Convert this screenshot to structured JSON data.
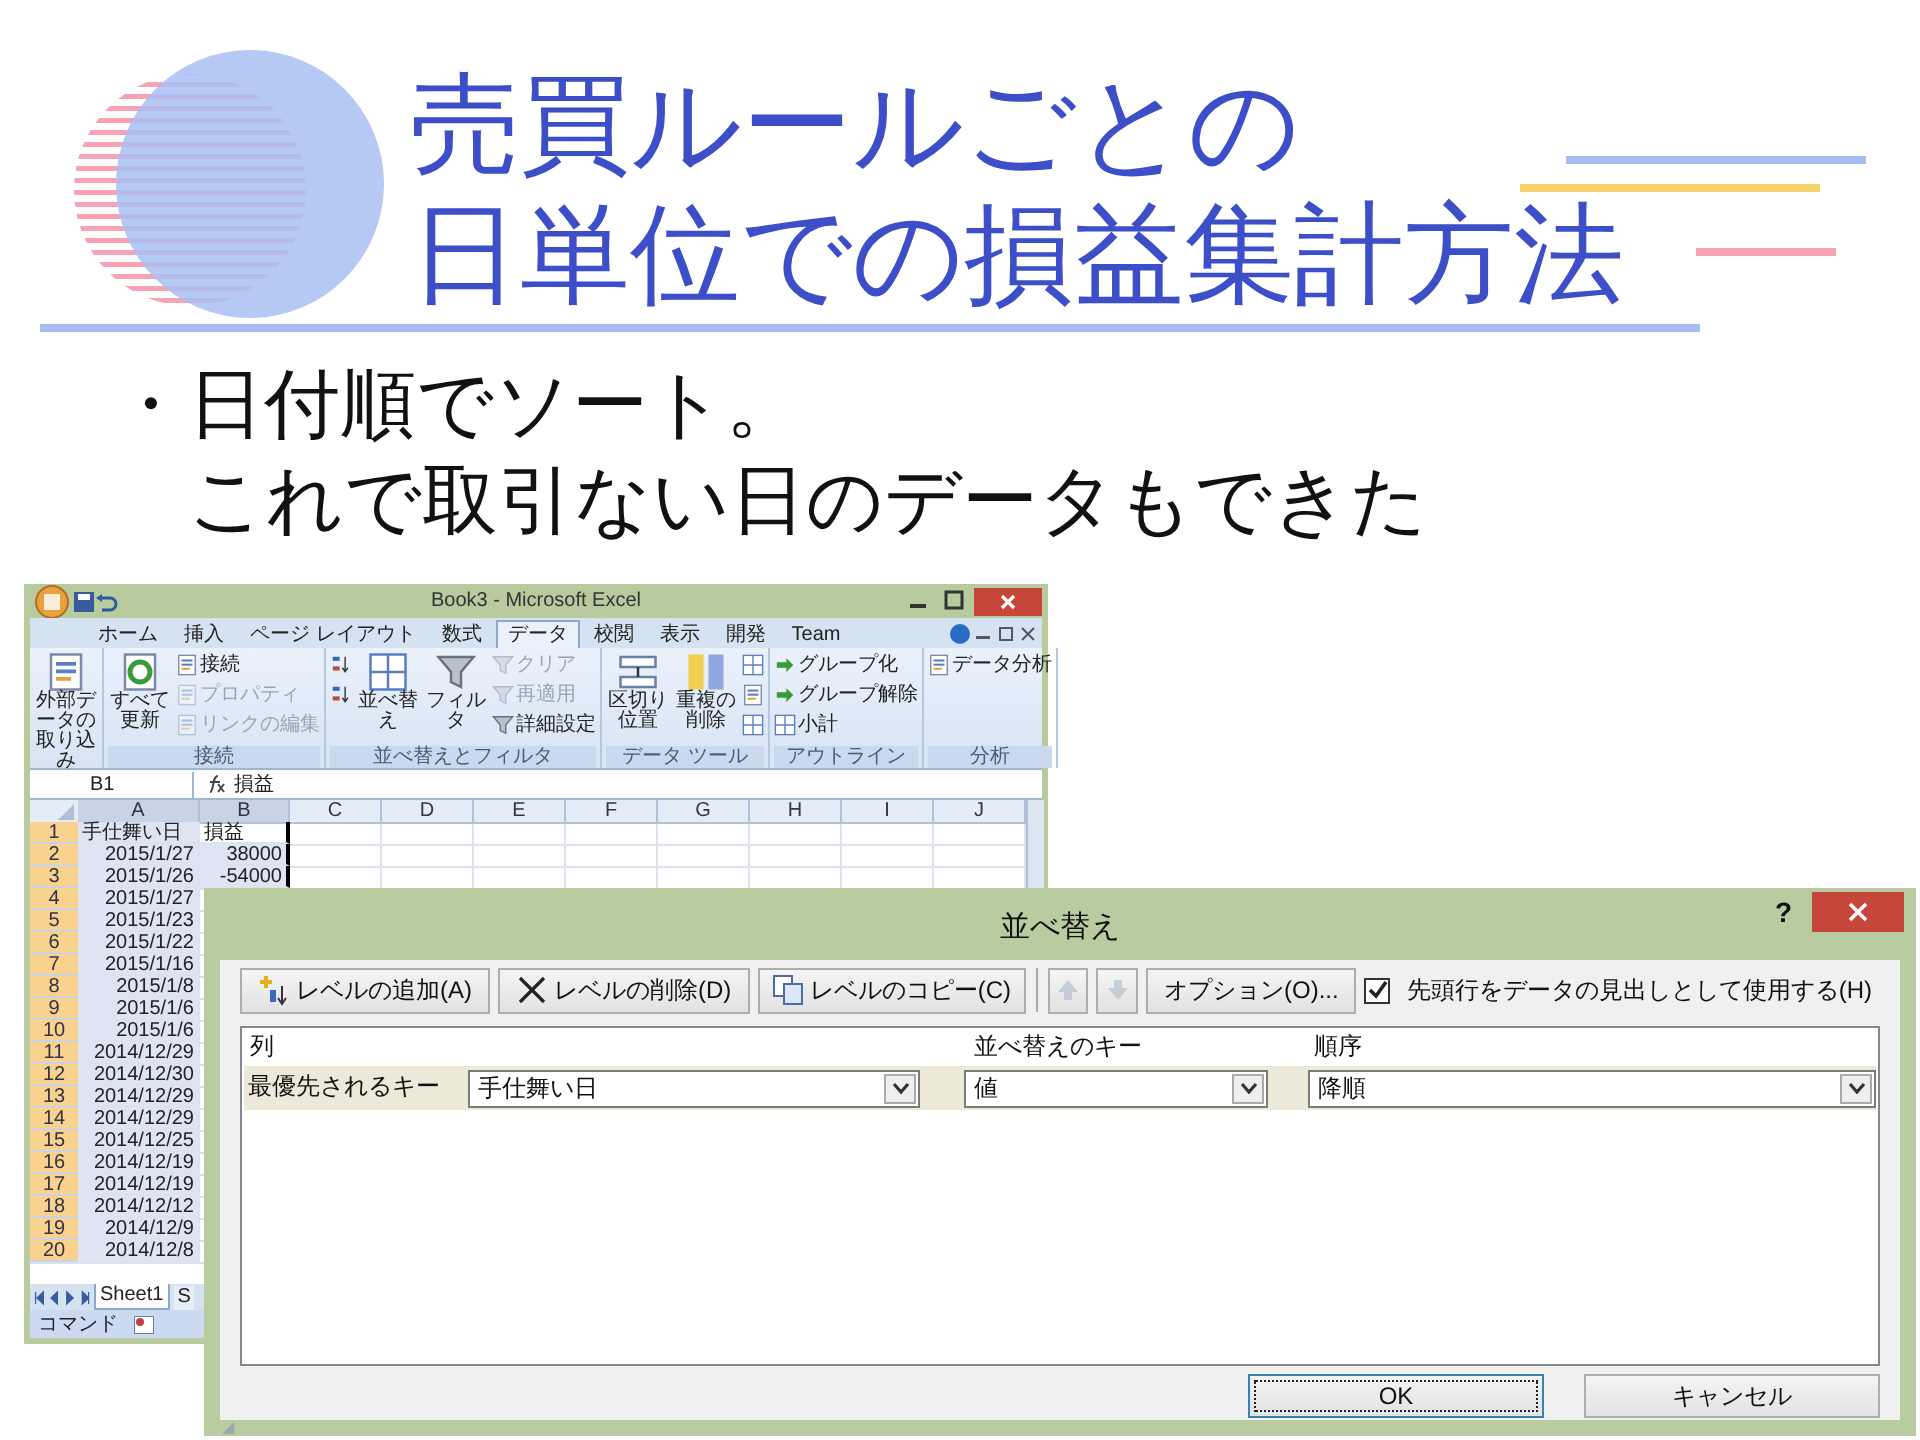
{
  "slide": {
    "title_lines": [
      "売買ルールごとの",
      "日単位での損益集計方法"
    ],
    "bullet": {
      "marker": "・",
      "lines": [
        "日付順でソート。",
        "これで取引ない日のデータもできた"
      ]
    }
  },
  "excel": {
    "title": "Book3 - Microsoft Excel",
    "tabs": [
      {
        "label": "ホーム",
        "selected": false
      },
      {
        "label": "挿入",
        "selected": false
      },
      {
        "label": "ページ レイアウト",
        "selected": false
      },
      {
        "label": "数式",
        "selected": false
      },
      {
        "label": "データ",
        "selected": true
      },
      {
        "label": "校閲",
        "selected": false
      },
      {
        "label": "表示",
        "selected": false
      },
      {
        "label": "開発",
        "selected": false
      },
      {
        "label": "Team",
        "selected": false
      }
    ],
    "ribbon_groups": [
      {
        "items": [
          {
            "label": "外部データの取り込み",
            "kind": "large",
            "disabled": false
          }
        ]
      },
      {
        "label": "接続",
        "items": [
          {
            "label": "すべて更新",
            "kind": "large",
            "disabled": false
          },
          {
            "label": "接続",
            "kind": "small",
            "disabled": false
          },
          {
            "label": "プロパティ",
            "kind": "small",
            "disabled": true
          },
          {
            "label": "リンクの編集",
            "kind": "small",
            "disabled": true
          }
        ]
      },
      {
        "label": "並べ替えとフィルタ",
        "items": [
          {
            "kind": "icon",
            "disabled": false
          },
          {
            "kind": "icon",
            "disabled": false
          },
          {
            "label": "並べ替え",
            "kind": "large",
            "disabled": false
          },
          {
            "label": "フィルタ",
            "kind": "large",
            "disabled": false
          },
          {
            "label": "クリア",
            "kind": "small",
            "disabled": true
          },
          {
            "label": "再適用",
            "kind": "small",
            "disabled": true
          },
          {
            "label": "詳細設定",
            "kind": "small",
            "disabled": false
          }
        ]
      },
      {
        "label": "データ ツール",
        "items": [
          {
            "label": "区切り位置",
            "kind": "large",
            "disabled": false
          },
          {
            "label": "重複の削除",
            "kind": "large",
            "disabled": false
          },
          {
            "kind": "icon",
            "disabled": false
          },
          {
            "kind": "icon",
            "disabled": false
          },
          {
            "kind": "icon",
            "disabled": false
          }
        ]
      },
      {
        "label": "アウトライン",
        "items": [
          {
            "label": "グループ化",
            "kind": "small",
            "disabled": false
          },
          {
            "label": "グループ解除",
            "kind": "small",
            "disabled": false
          },
          {
            "label": "小計",
            "kind": "small",
            "disabled": false
          }
        ]
      },
      {
        "label": "分析",
        "items": [
          {
            "label": "データ分析",
            "kind": "small",
            "disabled": false
          }
        ]
      }
    ],
    "name_box": "B1",
    "formula": "損益",
    "columns": [
      {
        "label": "A",
        "selected": true
      },
      {
        "label": "B",
        "selected": true
      },
      {
        "label": "C",
        "selected": false
      },
      {
        "label": "D",
        "selected": false
      },
      {
        "label": "E",
        "selected": false
      },
      {
        "label": "F",
        "selected": false
      },
      {
        "label": "G",
        "selected": false
      },
      {
        "label": "H",
        "selected": false
      },
      {
        "label": "I",
        "selected": false
      },
      {
        "label": "J",
        "selected": false
      }
    ],
    "rows": [
      {
        "number": "1",
        "selected": true,
        "cells": [
          {
            "text": "手仕舞い日",
            "kind": "text"
          },
          {
            "text": "損益",
            "kind": "text"
          }
        ]
      },
      {
        "number": "2",
        "selected": true,
        "cells": [
          {
            "text": "2015/1/27",
            "kind": "number"
          },
          {
            "text": "38000",
            "kind": "number"
          }
        ]
      },
      {
        "number": "3",
        "selected": true,
        "cells": [
          {
            "text": "2015/1/26",
            "kind": "number"
          },
          {
            "text": "-54000",
            "kind": "number"
          }
        ]
      },
      {
        "number": "4",
        "selected": true,
        "cells": [
          {
            "text": "2015/1/27",
            "kind": "number"
          }
        ]
      },
      {
        "number": "5",
        "selected": true,
        "cells": [
          {
            "text": "2015/1/23",
            "kind": "number"
          }
        ]
      },
      {
        "number": "6",
        "selected": true,
        "cells": [
          {
            "text": "2015/1/22",
            "kind": "number"
          }
        ]
      },
      {
        "number": "7",
        "selected": true,
        "cells": [
          {
            "text": "2015/1/16",
            "kind": "number"
          }
        ]
      },
      {
        "number": "8",
        "selected": true,
        "cells": [
          {
            "text": "2015/1/8",
            "kind": "number"
          }
        ]
      },
      {
        "number": "9",
        "selected": true,
        "cells": [
          {
            "text": "2015/1/6",
            "kind": "number"
          }
        ]
      },
      {
        "number": "10",
        "selected": true,
        "cells": [
          {
            "text": "2015/1/6",
            "kind": "number"
          }
        ]
      },
      {
        "number": "11",
        "selected": true,
        "cells": [
          {
            "text": "2014/12/29",
            "kind": "number"
          }
        ]
      },
      {
        "number": "12",
        "selected": true,
        "cells": [
          {
            "text": "2014/12/30",
            "kind": "number"
          }
        ]
      },
      {
        "number": "13",
        "selected": true,
        "cells": [
          {
            "text": "2014/12/29",
            "kind": "number"
          }
        ]
      },
      {
        "number": "14",
        "selected": true,
        "cells": [
          {
            "text": "2014/12/29",
            "kind": "number"
          }
        ]
      },
      {
        "number": "15",
        "selected": true,
        "cells": [
          {
            "text": "2014/12/25",
            "kind": "number"
          }
        ]
      },
      {
        "number": "16",
        "selected": true,
        "cells": [
          {
            "text": "2014/12/19",
            "kind": "number"
          }
        ]
      },
      {
        "number": "17",
        "selected": true,
        "cells": [
          {
            "text": "2014/12/19",
            "kind": "number"
          }
        ]
      },
      {
        "number": "18",
        "selected": true,
        "cells": [
          {
            "text": "2014/12/12",
            "kind": "number"
          }
        ]
      },
      {
        "number": "19",
        "selected": true,
        "cells": [
          {
            "text": "2014/12/9",
            "kind": "number"
          }
        ]
      },
      {
        "number": "20",
        "selected": true,
        "cells": [
          {
            "text": "2014/12/8",
            "kind": "number"
          }
        ]
      }
    ],
    "sheet_tabs": [
      {
        "label": "Sheet1",
        "selected": true
      },
      {
        "label": "S",
        "selected": false
      }
    ],
    "status": "コマンド"
  },
  "dialog": {
    "title": "並べ替え",
    "help": "?",
    "toolbar": [
      {
        "label": "レベルの追加(A)",
        "kind": "add",
        "disabled": false
      },
      {
        "label": "レベルの削除(D)",
        "kind": "delete",
        "disabled": false
      },
      {
        "label": "レベルのコピー(C)",
        "kind": "copy",
        "disabled": false
      },
      {
        "kind": "up",
        "disabled": true
      },
      {
        "kind": "down",
        "disabled": true
      },
      {
        "label": "オプション(O)...",
        "kind": "text",
        "disabled": false
      }
    ],
    "header_checkbox": {
      "label": "先頭行をデータの見出しとして使用する(H)",
      "checked": true
    },
    "columns": [
      "列",
      "並べ替えのキー",
      "順序"
    ],
    "levels": [
      {
        "label": "最優先されるキー",
        "column": "手仕舞い日",
        "key": "値",
        "order": "降順"
      }
    ],
    "buttons": [
      {
        "label": "OK",
        "focused": true
      },
      {
        "label": "キャンセル",
        "focused": false
      }
    ]
  }
}
